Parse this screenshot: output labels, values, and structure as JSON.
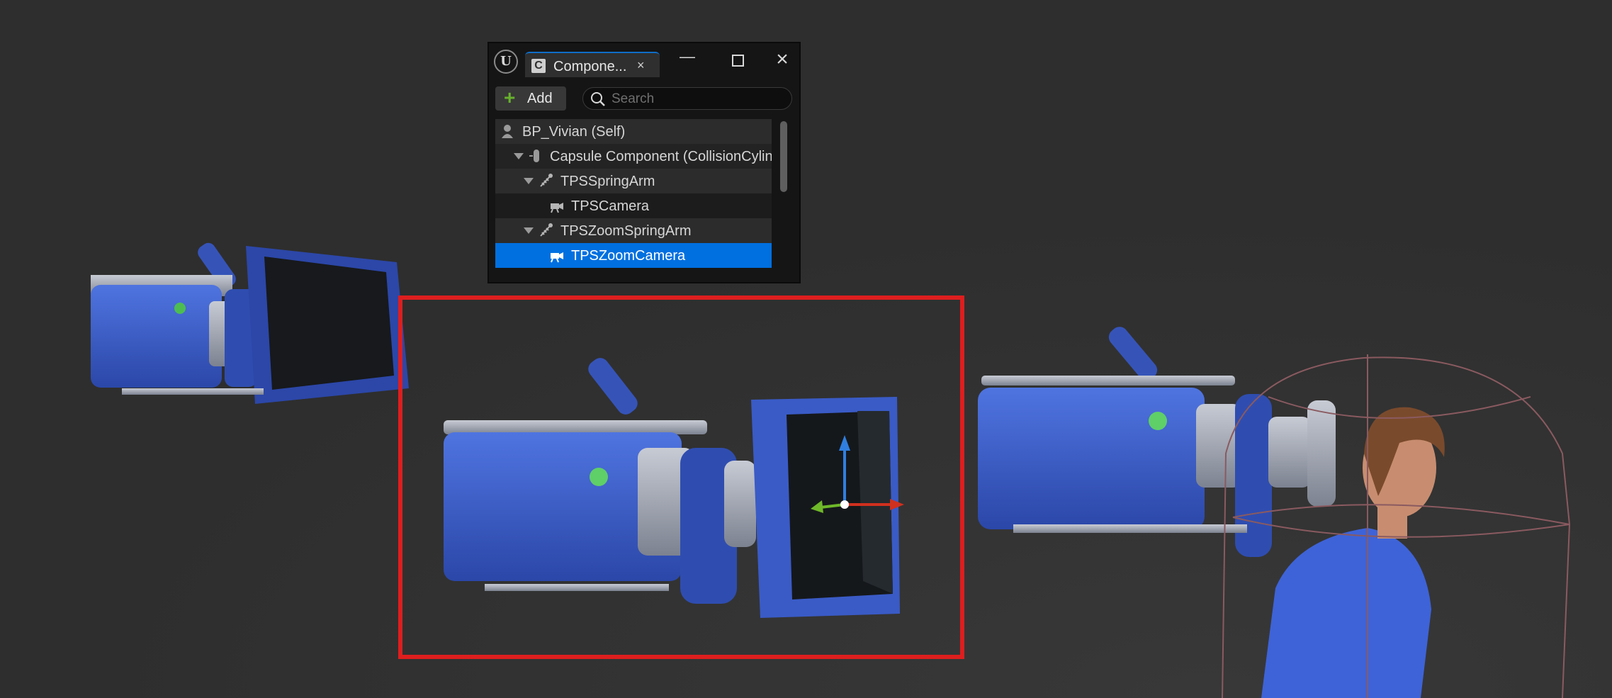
{
  "panel": {
    "app_icon": "unreal-engine-logo",
    "tab": {
      "icon": "component-icon",
      "label": "Compone...",
      "close_glyph": "×"
    },
    "window_buttons": [
      "minimize",
      "maximize",
      "close"
    ],
    "add_button": {
      "label": "Add",
      "icon": "plus-icon"
    },
    "search": {
      "placeholder": "Search",
      "value": ""
    },
    "tree": [
      {
        "label": "BP_Vivian (Self)",
        "icon": "actor-icon",
        "level": 0,
        "expanded": null,
        "selected": false
      },
      {
        "label": "Capsule Component (CollisionCylinder)",
        "icon": "capsule-icon",
        "level": 1,
        "expanded": true,
        "selected": false
      },
      {
        "label": "TPSSpringArm",
        "icon": "spring-arm-icon",
        "level": 2,
        "expanded": true,
        "selected": false
      },
      {
        "label": "TPSCamera",
        "icon": "camera-icon",
        "level": 3,
        "expanded": null,
        "selected": false
      },
      {
        "label": "TPSZoomSpringArm",
        "icon": "spring-arm-icon",
        "level": 2,
        "expanded": true,
        "selected": false
      },
      {
        "label": "TPSZoomCamera",
        "icon": "camera-icon",
        "level": 3,
        "expanded": null,
        "selected": true
      }
    ],
    "selection_color": "#0070e0"
  },
  "viewport": {
    "background": "#2e2e2e",
    "camera_color": "#3b5ec8",
    "selection_outline_color": "#de1e1e",
    "gizmo_colors": {
      "x": "#d0301e",
      "y": "#6fb82a",
      "z": "#2f7fe0"
    }
  }
}
